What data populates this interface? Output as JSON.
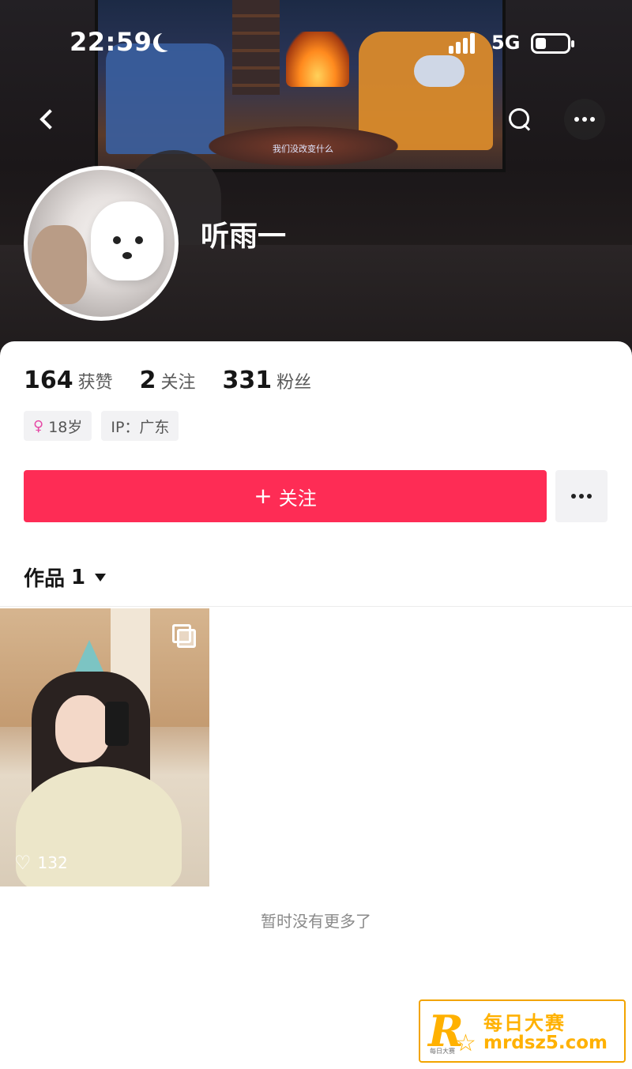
{
  "status_bar": {
    "time": "22:59",
    "network": "5G",
    "battery_level": 0.35
  },
  "cover": {
    "tv_caption": "我们没改变什么"
  },
  "profile": {
    "username": "听雨一",
    "stats": [
      {
        "value": "164",
        "label": "获赞"
      },
      {
        "value": "2",
        "label": "关注"
      },
      {
        "value": "331",
        "label": "粉丝"
      }
    ],
    "tags": {
      "age": "18岁",
      "ip": "IP：广东"
    }
  },
  "actions": {
    "follow_label": "关注",
    "follow_plus": "+"
  },
  "works": {
    "tab_label": "作品",
    "count": "1",
    "items": [
      {
        "likes": "132"
      }
    ],
    "end_text": "暂时没有更多了"
  },
  "watermark": {
    "letter": "R",
    "chinese": "每日大赛",
    "site": "mrdsz5.com",
    "small": "每日大赛"
  },
  "colors": {
    "accent": "#fe2c55",
    "watermark": "#ffb100"
  },
  "icons": [
    "back-icon",
    "search-icon",
    "more-icon",
    "gender-female-icon",
    "caret-down-icon",
    "multi-image-icon",
    "heart-icon",
    "moon-icon",
    "signal-icon",
    "battery-icon"
  ]
}
